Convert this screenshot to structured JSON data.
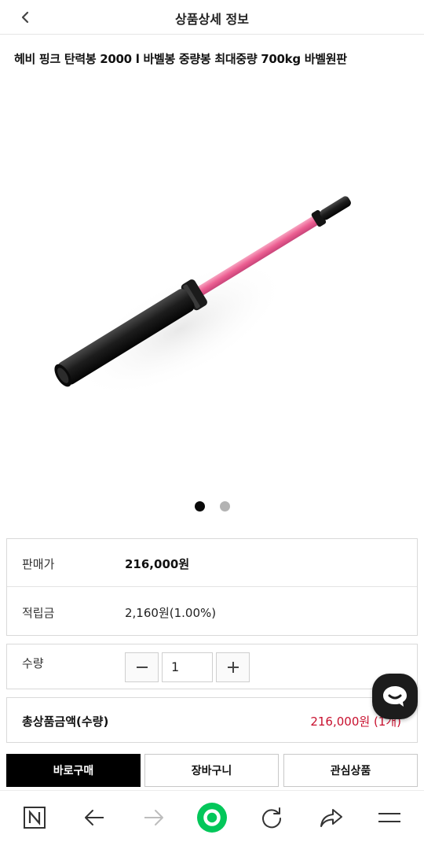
{
  "header": {
    "title": "상품상세 정보",
    "back_icon": "chevron-left-icon"
  },
  "product": {
    "title": "헤비 핑크 탄력봉 2000 l 바벨봉 중량봉 최대중량 700kg 바벨원판",
    "image_desc": "pink-black-barbell",
    "carousel": {
      "total": 2,
      "active_index": 0
    }
  },
  "info": {
    "price_label": "판매가",
    "price_value": "216,000원",
    "points_label": "적립금",
    "points_value": "2,160원(1.00%)"
  },
  "quantity": {
    "label": "수량",
    "value": "1"
  },
  "total": {
    "label": "총상품금액(수량)",
    "value": "216,000원 (1개)"
  },
  "actions": {
    "buy_label": "바로구매",
    "cart_label": "장바구니",
    "wish_label": "관심상품"
  },
  "chat": {
    "icon": "chat-bubble-icon"
  },
  "browser_nav": {
    "items": [
      "naver-n-icon",
      "arrow-left-icon",
      "arrow-right-icon",
      "green-home-icon",
      "reload-icon",
      "share-icon",
      "menu-icon"
    ]
  },
  "colors": {
    "accent_red": "#c8102e",
    "buy_button": "#000000",
    "naver_green": "#03c75a",
    "barbell_pink": "#ef6f9c"
  }
}
